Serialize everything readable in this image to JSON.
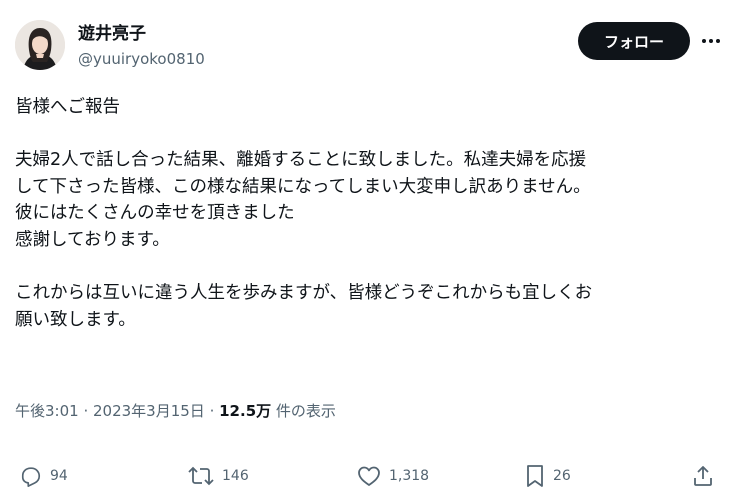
{
  "author": {
    "name": "遊井亮子",
    "handle": "@yuuiryoko0810"
  },
  "follow_label": "フォロー",
  "tweet_lines": [
    "皆様へご報告",
    "",
    "夫婦2人で話し合った結果、離婚することに致しました。私達夫婦を応援",
    "して下さった皆様、この様な結果になってしまい大変申し訳ありません。",
    "彼にはたくさんの幸せを頂きました",
    "感謝しております。",
    "",
    "これからは互いに違う人生を歩みますが、皆様どうぞこれからも宜しくお",
    "願い致します。"
  ],
  "meta": {
    "time": "午後3:01",
    "separator": " · ",
    "date": "2023年3月15日",
    "views_count": "12.5万",
    "views_label": " 件の表示"
  },
  "actions": {
    "replies": "94",
    "reposts": "146",
    "likes": "1,318",
    "bookmarks": "26"
  },
  "icons": {
    "more": "more-icon",
    "reply": "reply-icon",
    "repost": "repost-icon",
    "like": "heart-icon",
    "bookmark": "bookmark-icon",
    "share": "share-icon"
  },
  "colors": {
    "primary_text": "#0f1419",
    "secondary_text": "#536471",
    "follow_button": "#0f1419"
  }
}
